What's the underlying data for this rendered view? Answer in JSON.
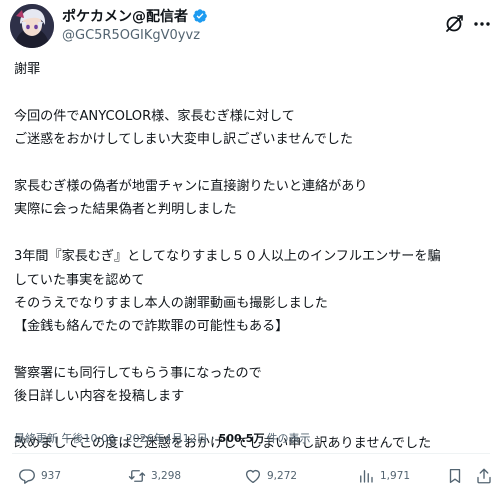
{
  "author": {
    "display_name": "ポケカメン@配信者",
    "handle": "@GC5R5OGIKgV0yvz",
    "verified": true
  },
  "post": {
    "lines": [
      "謝罪",
      "",
      "今回の件でANYCOLOR様、家長むぎ様に対して",
      "ご迷惑をおかけしてしまい大変申し訳ございませんでした",
      "",
      "家長むぎ様の偽者が地雷チャンに直接謝りたいと連絡があり",
      "実際に会った結果偽者と判明しました",
      "",
      "3年間『家長むぎ』としてなりすまし５０人以上のインフルエンサーを騙",
      "していた事実を認めて",
      "そのうえでなりすまし本人の謝罪動画も撮影しました",
      "【金銭も絡んでたので詐欺罪の可能性もある】",
      "",
      "警察署にも同行してもらう事になったので",
      "後日詳しい内容を投稿します",
      "",
      "改めましてこの度はご迷惑をおかけしてしまい申し訳ありませんでした"
    ]
  },
  "meta": {
    "timestamp": "最終更新 午後10:00 · 2026年4月12日 · ",
    "views": "500.5万",
    "views_label": "件の表示"
  },
  "actions": {
    "replies": "937",
    "reposts": "3,298",
    "likes": "9,272",
    "views": "1,971"
  },
  "icons": {
    "verified": "verified-badge-icon",
    "grok": "grok-icon",
    "more": "more-icon",
    "reply": "reply-icon",
    "repost": "repost-icon",
    "like": "heart-icon",
    "stats": "stats-icon",
    "bookmark": "bookmark-icon",
    "share": "share-icon"
  },
  "colors": {
    "text": "#0f1419",
    "secondary": "#536471",
    "verified": "#1d9bf0"
  }
}
